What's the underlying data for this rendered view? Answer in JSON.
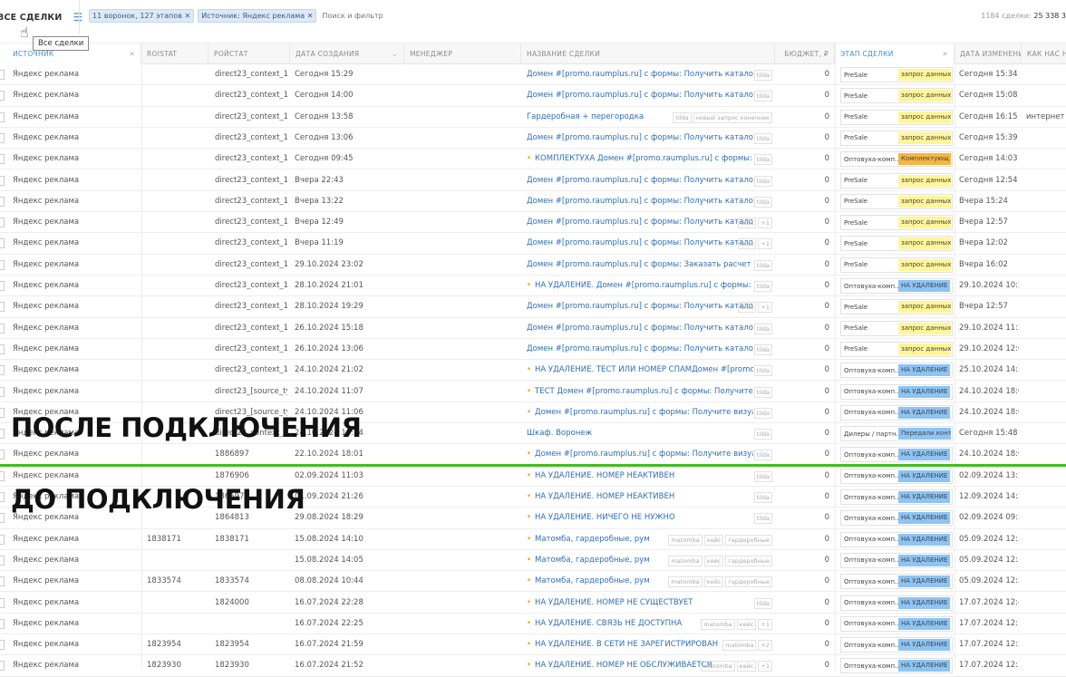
{
  "header": {
    "title": "ВСЕ СДЕЛКИ",
    "filters": [
      "11 воронок, 127 этапов",
      "Источник: Яндекс реклама"
    ],
    "search_placeholder": "Поиск и фильтр",
    "total_label": "1184 сделки:",
    "total_value": "25 338 3",
    "tooltip": "Все сделки"
  },
  "columns": {
    "source": "ИСТОЧНИК",
    "roistat": "ROISTAT",
    "roystat": "РОЙСТАТ",
    "created": "ДАТА СОЗДАНИЯ",
    "manager": "МЕНЕДЖЕР",
    "name": "НАЗВАНИЕ СДЕЛКИ",
    "budget": "БЮДЖЕТ, ₽",
    "stage": "ЭТАП СДЕЛКИ",
    "changed": "ДАТА ИЗМЕНЕНИ",
    "how": "КАК НАС НА"
  },
  "stage_colors": {
    "yellow": "#fff59a",
    "orange": "#f5b642",
    "blue": "#8cc4f5"
  },
  "overlay": {
    "after": "ПОСЛЕ ПОДКЛЮЧЕНИЯ",
    "before": "ДО ПОДКЛЮЧЕНИЯ",
    "divider_color": "#3fbf1f"
  },
  "rows": [
    {
      "src": "Яндекс реклама",
      "roi": "",
      "roy": "direct23_context_16",
      "created": "Сегодня 15:29",
      "name": "Домен #[promo.raumplus.ru] с формы: Получить каталог",
      "dot": false,
      "tags": [
        "tilda"
      ],
      "budget": "0",
      "pipe": "PreSale",
      "stage": "запрос данных 1",
      "color": "yellow",
      "changed": "Сегодня 15:34",
      "how": ""
    },
    {
      "src": "Яндекс реклама",
      "roi": "",
      "roy": "direct23_context_16",
      "created": "Сегодня 14:00",
      "name": "Домен #[promo.raumplus.ru] с формы: Получить каталог",
      "dot": false,
      "tags": [
        "tilda"
      ],
      "budget": "0",
      "pipe": "PreSale",
      "stage": "запрос данных 1",
      "color": "yellow",
      "changed": "Сегодня 15:08",
      "how": ""
    },
    {
      "src": "Яндекс реклама",
      "roi": "",
      "roy": "direct23_context_16",
      "created": "Сегодня 13:58",
      "name": "Гардеробная + перегородка",
      "dot": false,
      "tags": [
        "tilda",
        "новый запрос конечник"
      ],
      "budget": "0",
      "pipe": "PreSale",
      "stage": "запрос данных 1",
      "color": "yellow",
      "changed": "Сегодня 16:15",
      "how": "интернет"
    },
    {
      "src": "Яндекс реклама",
      "roi": "",
      "roy": "direct23_context_16",
      "created": "Сегодня 13:06",
      "name": "Домен #[promo.raumplus.ru] с формы: Получить каталог",
      "dot": false,
      "tags": [
        "tilda"
      ],
      "budget": "0",
      "pipe": "PreSale",
      "stage": "запрос данных 1",
      "color": "yellow",
      "changed": "Сегодня 15:39",
      "how": ""
    },
    {
      "src": "Яндекс реклама",
      "roi": "",
      "roy": "direct23_context_16",
      "created": "Сегодня 09:45",
      "name": "КОМПЛЕКТУХА Домен #[promo.raumplus.ru] с формы: Получит",
      "dot": true,
      "tags": [
        "tilda"
      ],
      "budget": "0",
      "pipe": "Оптовуха-комп...",
      "stage": "Комплектующ",
      "color": "orange",
      "changed": "Сегодня 14:03",
      "how": ""
    },
    {
      "src": "Яндекс реклама",
      "roi": "",
      "roy": "direct23_context_16",
      "created": "Вчера 22:43",
      "name": "Домен #[promo.raumplus.ru] с формы: Получить каталог",
      "dot": false,
      "tags": [
        "tilda"
      ],
      "budget": "0",
      "pipe": "PreSale",
      "stage": "запрос данных 1",
      "color": "yellow",
      "changed": "Сегодня 12:54",
      "how": ""
    },
    {
      "src": "Яндекс реклама",
      "roi": "",
      "roy": "direct23_context_16",
      "created": "Вчера 13:22",
      "name": "Домен #[promo.raumplus.ru] с формы: Получить каталог",
      "dot": false,
      "tags": [
        "tilda"
      ],
      "budget": "0",
      "pipe": "PreSale",
      "stage": "запрос данных 1",
      "color": "yellow",
      "changed": "Вчера 15:24",
      "how": ""
    },
    {
      "src": "Яндекс реклама",
      "roi": "",
      "roy": "direct23_context_16",
      "created": "Вчера 12:49",
      "name": "Домен #[promo.raumplus.ru] с формы: Получить каталог",
      "dot": false,
      "tags": [
        "tilda",
        "+1"
      ],
      "budget": "0",
      "pipe": "PreSale",
      "stage": "запрос данных 1",
      "color": "yellow",
      "changed": "Вчера 12:57",
      "how": ""
    },
    {
      "src": "Яндекс реклама",
      "roi": "",
      "roy": "direct23_context_16",
      "created": "Вчера 11:19",
      "name": "Домен #[promo.raumplus.ru] с формы: Получить каталог",
      "dot": false,
      "tags": [
        "tilda",
        "+1"
      ],
      "budget": "0",
      "pipe": "PreSale",
      "stage": "запрос данных 1",
      "color": "yellow",
      "changed": "Вчера 12:02",
      "how": ""
    },
    {
      "src": "Яндекс реклама",
      "roi": "",
      "roy": "direct23_context_16",
      "created": "29.10.2024 23:02",
      "name": "Домен #[promo.raumplus.ru] с формы: Заказать расчет",
      "dot": false,
      "tags": [
        "tilda"
      ],
      "budget": "0",
      "pipe": "PreSale",
      "stage": "запрос данных 1",
      "color": "yellow",
      "changed": "Вчера 16:02",
      "how": ""
    },
    {
      "src": "Яндекс реклама",
      "roi": "",
      "roy": "direct23_context_16",
      "created": "28.10.2024 21:01",
      "name": "НА УДАЛЕНИЕ. Домен #[promo.raumplus.ru] с формы: Получит",
      "dot": true,
      "tags": [
        "tilda"
      ],
      "budget": "0",
      "pipe": "Оптовуха-комп...",
      "stage": "НА УДАЛЕНИЕ",
      "color": "blue",
      "changed": "29.10.2024 10:2",
      "how": ""
    },
    {
      "src": "Яндекс реклама",
      "roi": "",
      "roy": "direct23_context_16",
      "created": "28.10.2024 19:29",
      "name": "Домен #[promo.raumplus.ru] с формы: Получить каталог",
      "dot": false,
      "tags": [
        "tilda",
        "+1"
      ],
      "budget": "0",
      "pipe": "PreSale",
      "stage": "запрос данных 1",
      "color": "yellow",
      "changed": "Вчера 12:57",
      "how": ""
    },
    {
      "src": "Яндекс реклама",
      "roi": "",
      "roy": "direct23_context_16",
      "created": "26.10.2024 15:18",
      "name": "Домен #[promo.raumplus.ru] с формы: Получить каталог",
      "dot": false,
      "tags": [
        "tilda"
      ],
      "budget": "0",
      "pipe": "PreSale",
      "stage": "запрос данных 1",
      "color": "yellow",
      "changed": "29.10.2024 11:2",
      "how": ""
    },
    {
      "src": "Яндекс реклама",
      "roi": "",
      "roy": "direct23_context_16",
      "created": "26.10.2024 13:06",
      "name": "Домен #[promo.raumplus.ru] с формы: Получить каталог",
      "dot": false,
      "tags": [
        "tilda"
      ],
      "budget": "0",
      "pipe": "PreSale",
      "stage": "запрос данных 1",
      "color": "yellow",
      "changed": "29.10.2024 12:0",
      "how": ""
    },
    {
      "src": "Яндекс реклама",
      "roi": "",
      "roy": "direct23_context_16",
      "created": "24.10.2024 21:02",
      "name": "НА УДАЛЕНИЕ. ТЕСТ ИЛИ НОМЕР СПАМДомен #[promo.raumpl",
      "dot": true,
      "tags": [
        "tilda"
      ],
      "budget": "0",
      "pipe": "Оптовуха-комп...",
      "stage": "НА УДАЛЕНИЕ",
      "color": "blue",
      "changed": "25.10.2024 14:5",
      "how": ""
    },
    {
      "src": "Яндекс реклама",
      "roi": "",
      "roy": "direct23_[source_typ",
      "created": "24.10.2024 11:07",
      "name": "ТЕСТ Домен #[promo.raumplus.ru] с формы: Получите визуали:",
      "dot": true,
      "tags": [
        "tilda"
      ],
      "budget": "0",
      "pipe": "Оптовуха-комп...",
      "stage": "НА УДАЛЕНИЕ",
      "color": "blue",
      "changed": "24.10.2024 18:0",
      "how": ""
    },
    {
      "src": "Яндекс реклама",
      "roi": "",
      "roy": "direct23_[source_typ",
      "created": "24.10.2024 11:06",
      "name": "Домен #[promo.raumplus.ru] с формы: Получите визуализацис",
      "dot": true,
      "tags": [
        "tilda"
      ],
      "budget": "0",
      "pipe": "Оптовуха-комп...",
      "stage": "НА УДАЛЕНИЕ",
      "color": "blue",
      "changed": "24.10.2024 18:0",
      "how": ""
    },
    {
      "src": "Яндекс реклама",
      "roi": "",
      "roy": "direct23_context_16",
      "created": "24.10.2024 10:14",
      "name": "Шкаф. Воронеж",
      "dot": false,
      "tags": [
        "tilda"
      ],
      "budget": "0",
      "pipe": "Дилеры / партн...",
      "stage": "Передали конт",
      "color": "blue",
      "changed": "Сегодня 15:48",
      "how": ""
    },
    {
      "src": "Яндекс реклама",
      "roi": "",
      "roy": "1886897",
      "created": "22.10.2024 18:01",
      "name": "Домен #[promo.raumplus.ru] с формы: Получите визуализацис",
      "dot": true,
      "tags": [
        "tilda"
      ],
      "budget": "0",
      "pipe": "Оптовуха-комп...",
      "stage": "НА УДАЛЕНИЕ",
      "color": "blue",
      "changed": "24.10.2024 18:0",
      "how": ""
    },
    {
      "src": "Яндекс реклама",
      "roi": "",
      "roy": "1876906",
      "created": "02.09.2024 11:03",
      "name": "НА УДАЛЕНИЕ. НОМЕР НЕАКТИВЕН",
      "dot": true,
      "tags": [
        "tilda"
      ],
      "budget": "0",
      "pipe": "Оптовуха-комп...",
      "stage": "НА УДАЛЕНИЕ",
      "color": "blue",
      "changed": "02.09.2024 13:2",
      "how": ""
    },
    {
      "src": "Яндекс реклама",
      "roi": "",
      "roy": "1865977",
      "created": "01.09.2024 21:26",
      "name": "НА УДАЛЕНИЕ. НОМЕР НЕАКТИВЕН",
      "dot": true,
      "tags": [
        "tilda"
      ],
      "budget": "0",
      "pipe": "Оптовуха-комп...",
      "stage": "НА УДАЛЕНИЕ",
      "color": "blue",
      "changed": "12.09.2024 14:5",
      "how": ""
    },
    {
      "src": "Яндекс реклама",
      "roi": "",
      "roy": "1864813",
      "created": "29.08.2024 18:29",
      "name": "НА УДАЛЕНИЕ. НИЧЕГО НЕ НУЖНО",
      "dot": true,
      "tags": [
        "tilda"
      ],
      "budget": "0",
      "pipe": "Оптовуха-комп...",
      "stage": "НА УДАЛЕНИЕ",
      "color": "blue",
      "changed": "02.09.2024 09:3",
      "how": ""
    },
    {
      "src": "Яндекс реклама",
      "roi": "1838171",
      "roy": "1838171",
      "created": "15.08.2024 14:10",
      "name": "Матомба, гардеробные, рум",
      "dot": true,
      "tags": [
        "matomba",
        "кейс",
        "гардеробные"
      ],
      "budget": "0",
      "pipe": "Оптовуха-комп...",
      "stage": "НА УДАЛЕНИЕ",
      "color": "blue",
      "changed": "05.09.2024 12:3",
      "how": ""
    },
    {
      "src": "Яндекс реклама",
      "roi": "",
      "roy": "",
      "created": "15.08.2024 14:05",
      "name": "Матомба, гардеробные, рум",
      "dot": true,
      "tags": [
        "matomba",
        "кейс",
        "гардеробные"
      ],
      "budget": "0",
      "pipe": "Оптовуха-комп...",
      "stage": "НА УДАЛЕНИЕ",
      "color": "blue",
      "changed": "05.09.2024 12:3",
      "how": ""
    },
    {
      "src": "Яндекс реклама",
      "roi": "1833574",
      "roy": "1833574",
      "created": "08.08.2024 10:44",
      "name": "Матомба, гардеробные, рум",
      "dot": true,
      "tags": [
        "matomba",
        "кейс",
        "гардеробные"
      ],
      "budget": "0",
      "pipe": "Оптовуха-комп...",
      "stage": "НА УДАЛЕНИЕ",
      "color": "blue",
      "changed": "05.09.2024 12:3",
      "how": ""
    },
    {
      "src": "Яндекс реклама",
      "roi": "",
      "roy": "1824000",
      "created": "16.07.2024 22:28",
      "name": "НА УДАЛЕНИЕ. НОМЕР НЕ СУЩЕСТВУЕТ",
      "dot": true,
      "tags": [
        "tilda"
      ],
      "budget": "0",
      "pipe": "Оптовуха-комп...",
      "stage": "НА УДАЛЕНИЕ",
      "color": "blue",
      "changed": "17.07.2024 12:4",
      "how": ""
    },
    {
      "src": "Яндекс реклама",
      "roi": "",
      "roy": "",
      "created": "16.07.2024 22:25",
      "name": "НА УДАЛЕНИЕ. СВЯЗЬ НЕ ДОСТУПНА",
      "dot": true,
      "tags": [
        "matomba",
        "кейс",
        "+1"
      ],
      "budget": "0",
      "pipe": "Оптовуха-комп...",
      "stage": "НА УДАЛЕНИЕ",
      "color": "blue",
      "changed": "17.07.2024 12:3",
      "how": ""
    },
    {
      "src": "Яндекс реклама",
      "roi": "1823954",
      "roy": "1823954",
      "created": "16.07.2024 21:59",
      "name": "НА УДАЛЕНИЕ. В СЕТИ НЕ ЗАРЕГИСТРИРОВАН",
      "dot": true,
      "tags": [
        "matomba",
        "+2"
      ],
      "budget": "0",
      "pipe": "Оптовуха-комп...",
      "stage": "НА УДАЛЕНИЕ",
      "color": "blue",
      "changed": "17.07.2024 12:3",
      "how": ""
    },
    {
      "src": "Яндекс реклама",
      "roi": "1823930",
      "roy": "1823930",
      "created": "16.07.2024 21:52",
      "name": "НА УДАЛЕНИЕ. НОМЕР НЕ ОБСЛУЖИВАЕТСЯ",
      "dot": true,
      "tags": [
        "matomba",
        "кейс",
        "+1"
      ],
      "budget": "0",
      "pipe": "Оптовуха-комп...",
      "stage": "НА УДАЛЕНИЕ",
      "color": "blue",
      "changed": "17.07.2024 12:3",
      "how": ""
    }
  ]
}
